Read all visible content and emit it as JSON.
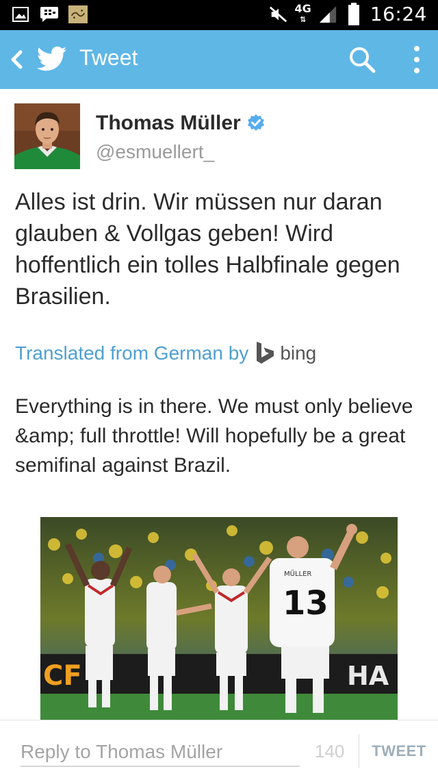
{
  "status_bar": {
    "time": "16:24",
    "network": "4G",
    "left_icons": [
      "image-icon",
      "bbm-icon",
      "app-icon"
    ],
    "right_icons": [
      "mute-icon",
      "signal-icon",
      "battery-icon"
    ]
  },
  "action_bar": {
    "title": "Tweet",
    "bg_color": "#5fb7e6"
  },
  "tweet": {
    "author_name": "Thomas Müller",
    "handle": "@esmuellert_",
    "verified": true,
    "text": "Alles ist drin. Wir müssen nur daran glauben & Vollgas geben! Wird hoffentlich ein tolles Halbfinale gegen Brasilien.",
    "translated_label": "Translated from German by",
    "translator": "bing",
    "translation": "Everything is in there. We must only believe &amp; full throttle! Will hopefully be a great semifinal against Brazil.",
    "photo_jersey_name": "MÜLLER",
    "photo_jersey_number": "13"
  },
  "reply": {
    "placeholder": "Reply to Thomas Müller",
    "count": "140",
    "button_label": "TWEET"
  },
  "colors": {
    "link": "#4f9fd1",
    "verified": "#55acee"
  }
}
